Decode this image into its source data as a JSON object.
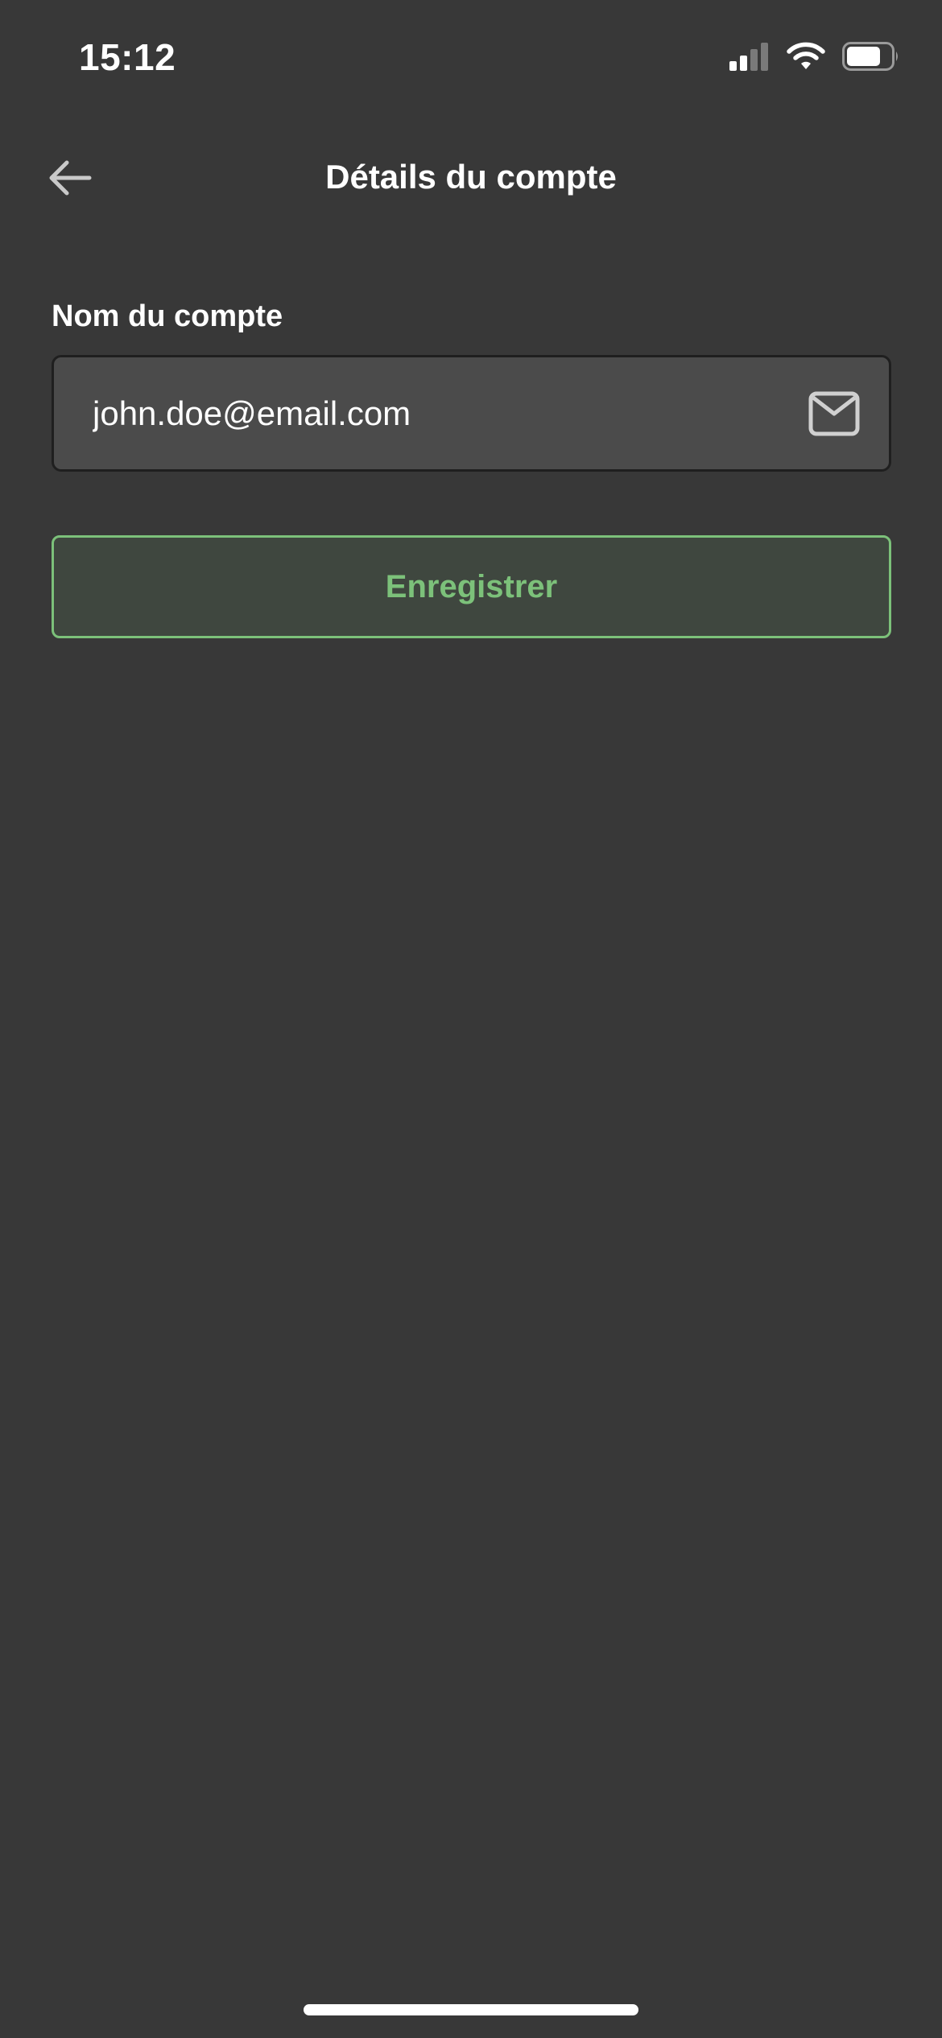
{
  "status_bar": {
    "time": "15:12",
    "icons": [
      "cellular-signal-icon",
      "wifi-icon",
      "battery-icon"
    ]
  },
  "header": {
    "title": "Détails du compte",
    "back_icon": "arrow-left-icon"
  },
  "form": {
    "account_name_label": "Nom du compte",
    "account_name_value": "john.doe@email.com",
    "field_icon": "mail-icon",
    "save_label": "Enregistrer"
  },
  "colors": {
    "background": "#383838",
    "input_background": "#4b4b4b",
    "accent": "#7cc17a"
  }
}
